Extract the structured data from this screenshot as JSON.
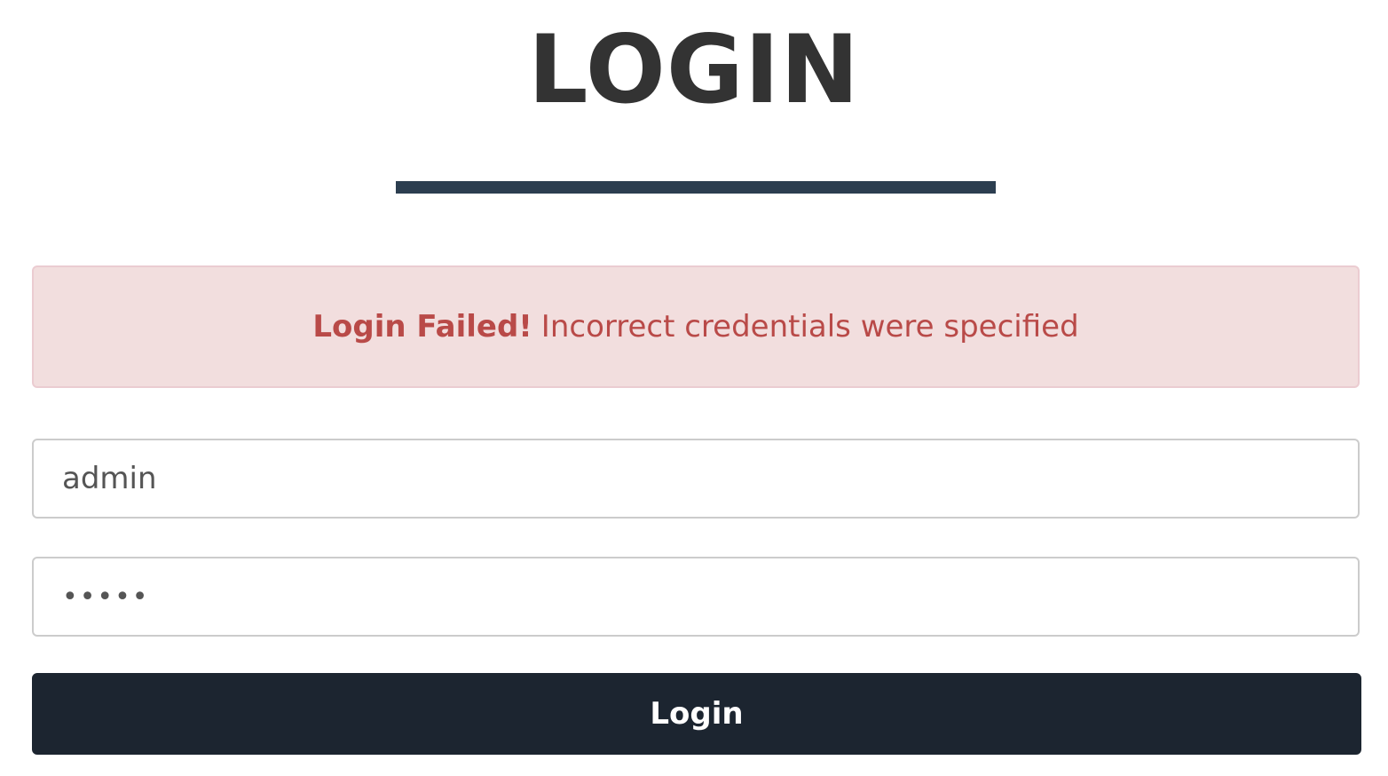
{
  "heading": {
    "title": "LOGIN"
  },
  "alert": {
    "strong": "Login Failed!",
    "message": "Incorrect credentials were specified",
    "background_color": "#f2dede",
    "text_color": "#b94a48"
  },
  "form": {
    "username_value": "admin",
    "password_value": "admin",
    "submit_label": "Login"
  },
  "colors": {
    "divider": "#2c3e50",
    "button": "#1c2530"
  }
}
